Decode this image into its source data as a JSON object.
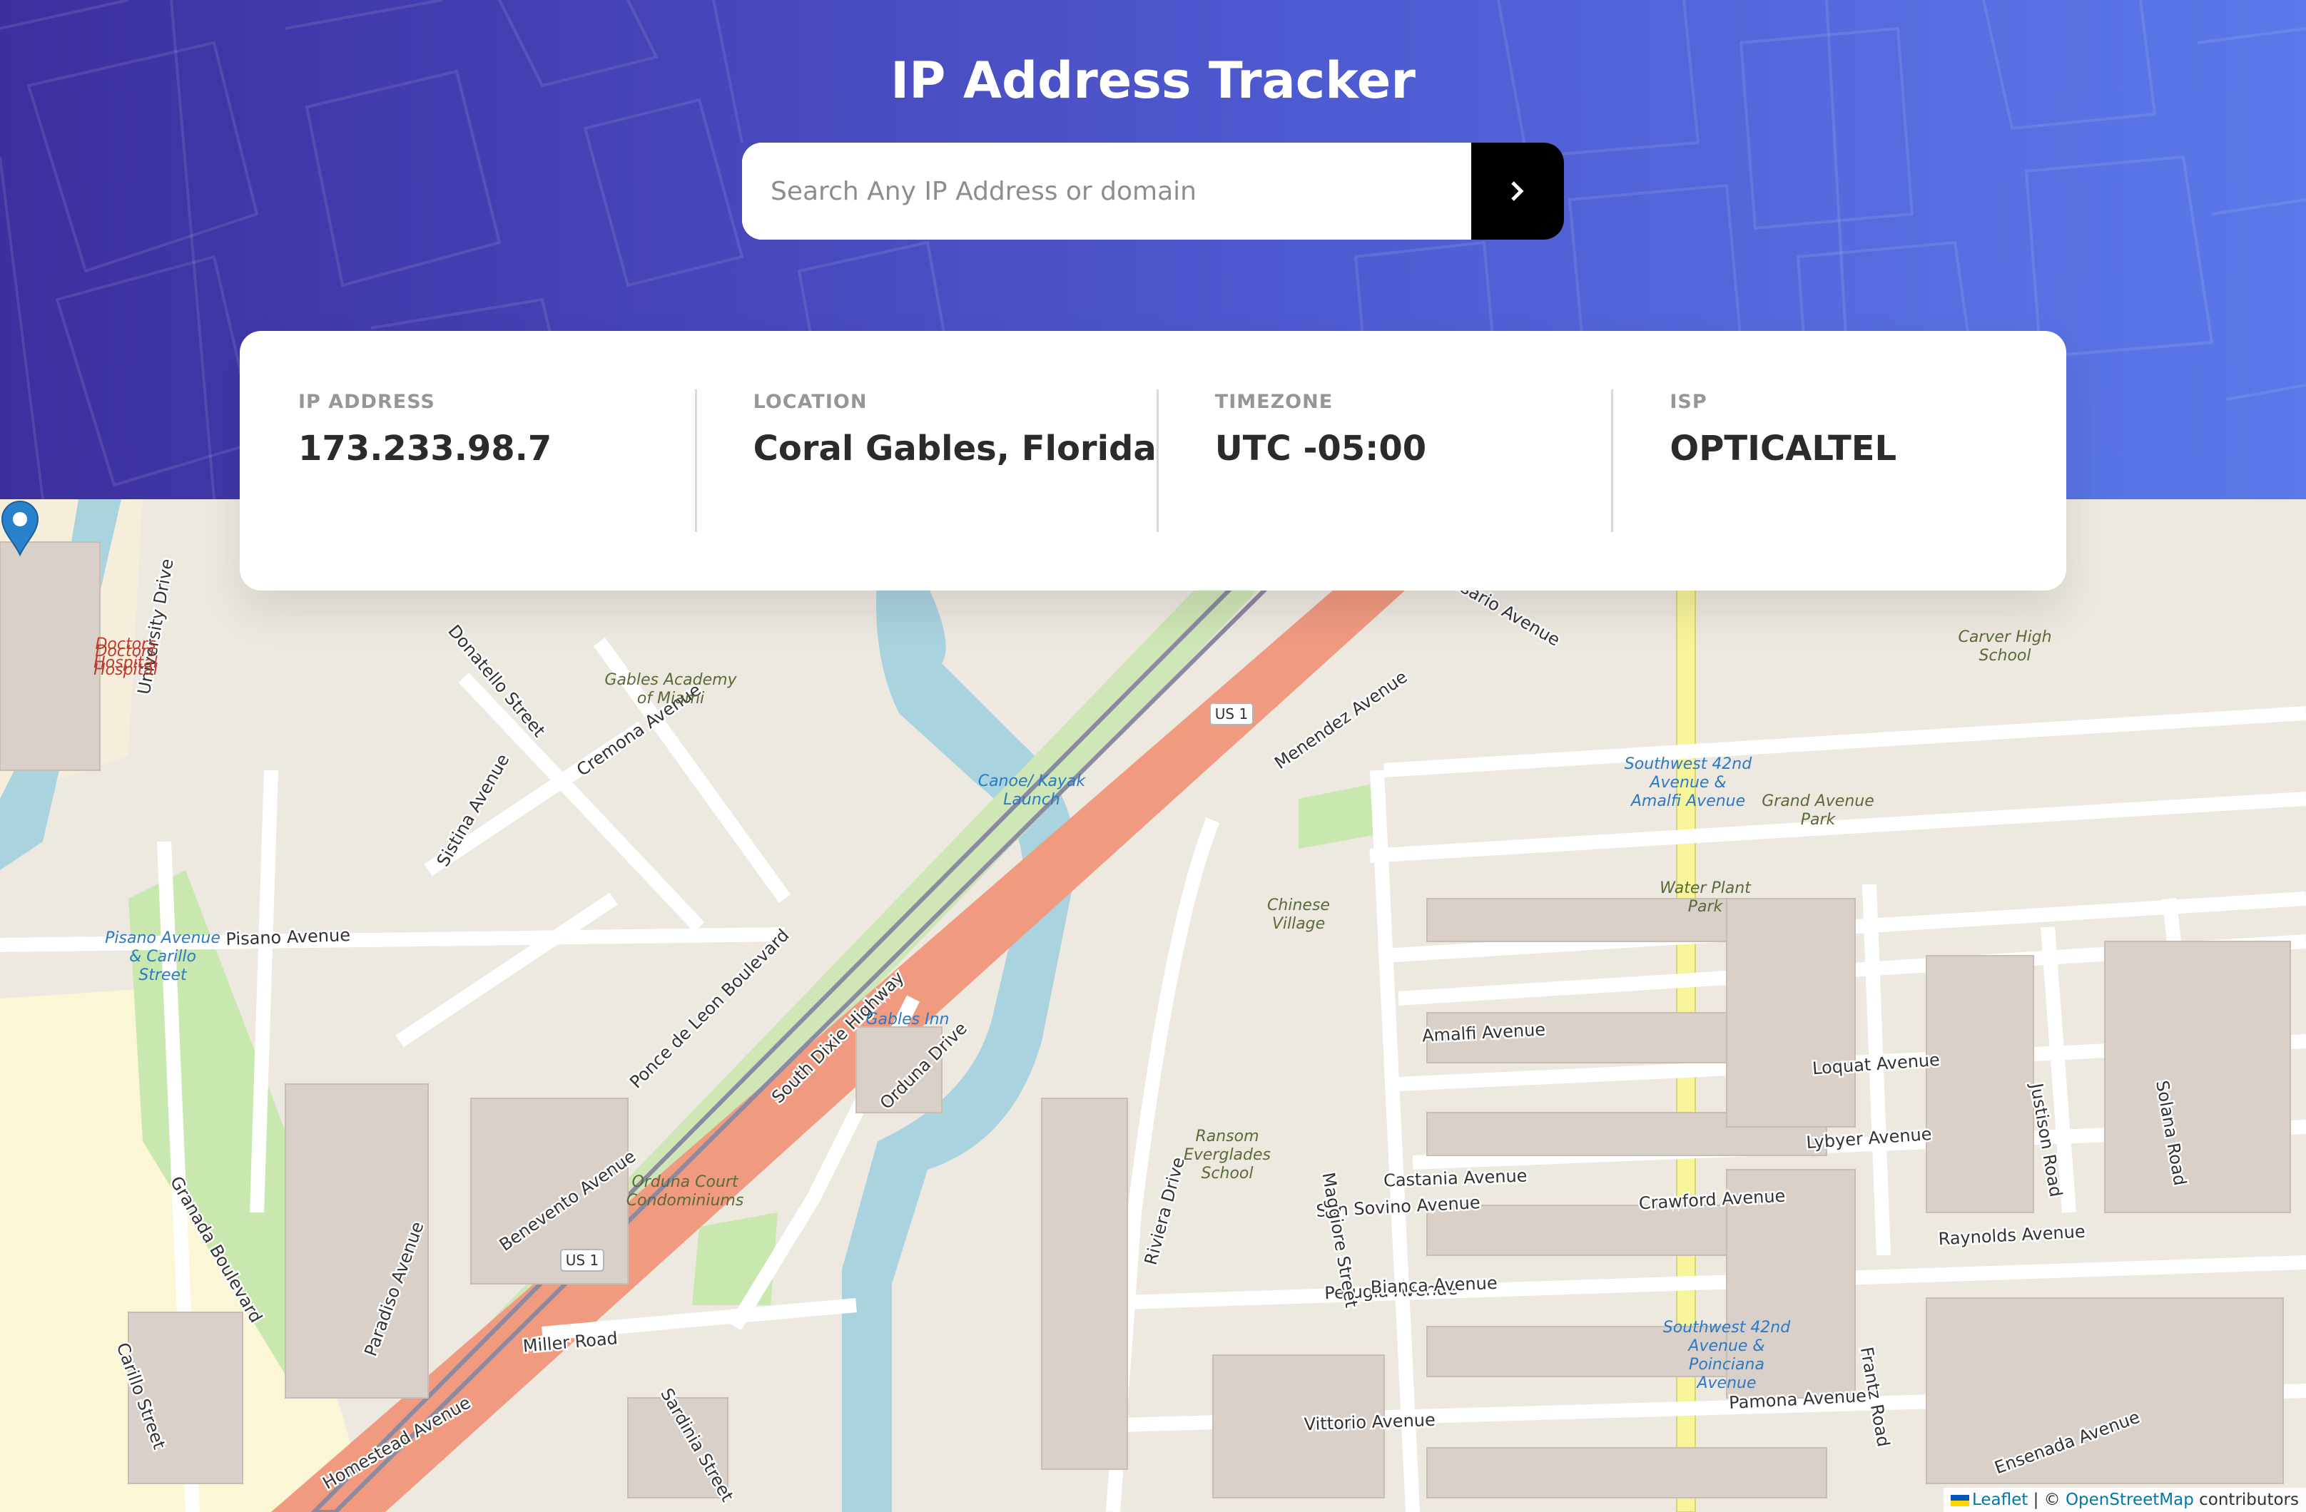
{
  "header": {
    "title": "IP Address Tracker",
    "search": {
      "placeholder": "Search Any IP Address or domain",
      "value": ""
    },
    "search_button_icon": "chevron-right-icon"
  },
  "info": {
    "ip_label": "IP ADDRESS",
    "ip_value": "173.233.98.7",
    "location_label": "LOCATION",
    "location_value": "Coral Gables, Florida",
    "timezone_label": "TIMEZONE",
    "timezone_value": "UTC -05:00",
    "isp_label": "ISP",
    "isp_value": "OPTICALTEL"
  },
  "map": {
    "marker_icon": "map-pin-icon",
    "street_labels": [
      "Ponce de Leon Boulevard",
      "South Dixie Highway",
      "Orduna Drive",
      "Miller Road",
      "Perugia Avenue",
      "Castania Avenue",
      "Bianca Avenue",
      "Raynolds Avenue",
      "Crawford Avenue",
      "Lybyer Avenue",
      "Loquat Avenue",
      "Amalfi Avenue",
      "San Sovino Avenue",
      "Vittorio Avenue",
      "Pamona Avenue",
      "Pisano Avenue",
      "Granada Boulevard",
      "Carillo Street",
      "Maggiore Street",
      "Riviera Drive",
      "Frantz Road",
      "Justison Road",
      "Solana Road",
      "Menendez Avenue",
      "Benevento Avenue",
      "Cremona Avenue",
      "Donatello Street",
      "Sistina Avenue",
      "Paradiso Avenue",
      "University Drive",
      "Sardinia Street",
      "Homestead Avenue",
      "Ensenada Avenue",
      "Rosario Avenue"
    ],
    "place_labels": [
      "Doctors Hospital",
      "Gables Academy of Miami",
      "Canoe/ Kayak Launch",
      "Chinese Village",
      "Gables Inn",
      "Orduna Court Condominiums",
      "Ransom Everglades School",
      "Carver High School",
      "Grand Avenue Park",
      "Water Plant Park",
      "Southwest 42nd Avenue & Amalfi Avenue",
      "Southwest 42nd Avenue & Poinciana Avenue",
      "Pisano Avenue & Carillo Street",
      "Doctors Hospital"
    ],
    "route_shields": [
      "US 1",
      "US 1"
    ]
  },
  "attribution": {
    "leaflet": "Leaflet",
    "separator": "| ©",
    "osm": "OpenStreetMap",
    "contributors": "contributors"
  },
  "colors": {
    "header_gradient_start": "#3d2f9e",
    "header_gradient_end": "#5b79e8",
    "map_background": "#ede8e0",
    "highway": "#f09a80",
    "park": "#c8e8b0",
    "water": "#a9d3df",
    "marker": "#2a81cb",
    "rail_corridor": "#e4d9a8"
  }
}
